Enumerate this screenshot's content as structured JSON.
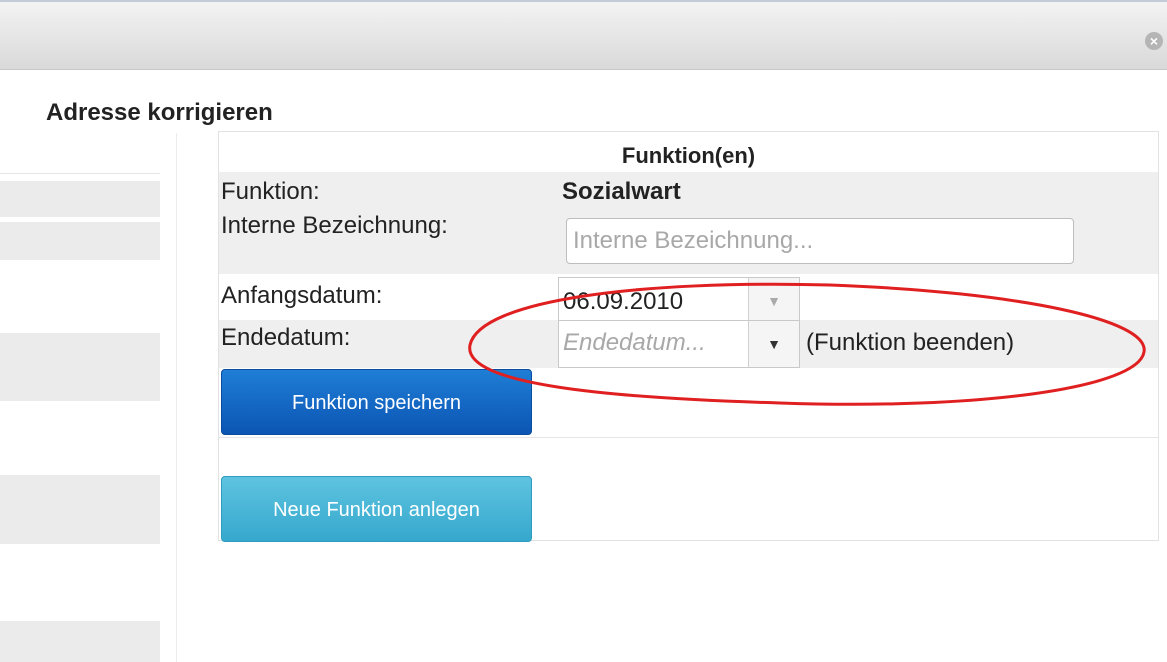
{
  "window": {
    "close_icon": "close-icon"
  },
  "dialog": {
    "title": "Adresse korrigieren"
  },
  "panel": {
    "title": "Funktion(en)",
    "funktion_label": "Funktion:",
    "funktion_value": "Sozialwart",
    "interne_label": "Interne Bezeichnung:",
    "interne_placeholder": "Interne Bezeichnung...",
    "anfang_label": "Anfangsdatum:",
    "anfang_value": "06.09.2010",
    "ende_label": "Endedatum:",
    "ende_placeholder": "Endedatum...",
    "ende_hint": "(Funktion beenden)",
    "save_button": "Funktion speichern",
    "new_button": "Neue Funktion anlegen"
  },
  "annotation": {
    "shape": "ellipse",
    "color": "#e02020"
  },
  "colors": {
    "primary": "#0b55b3",
    "info": "#36a8cd",
    "row_bg": "#efefef"
  }
}
